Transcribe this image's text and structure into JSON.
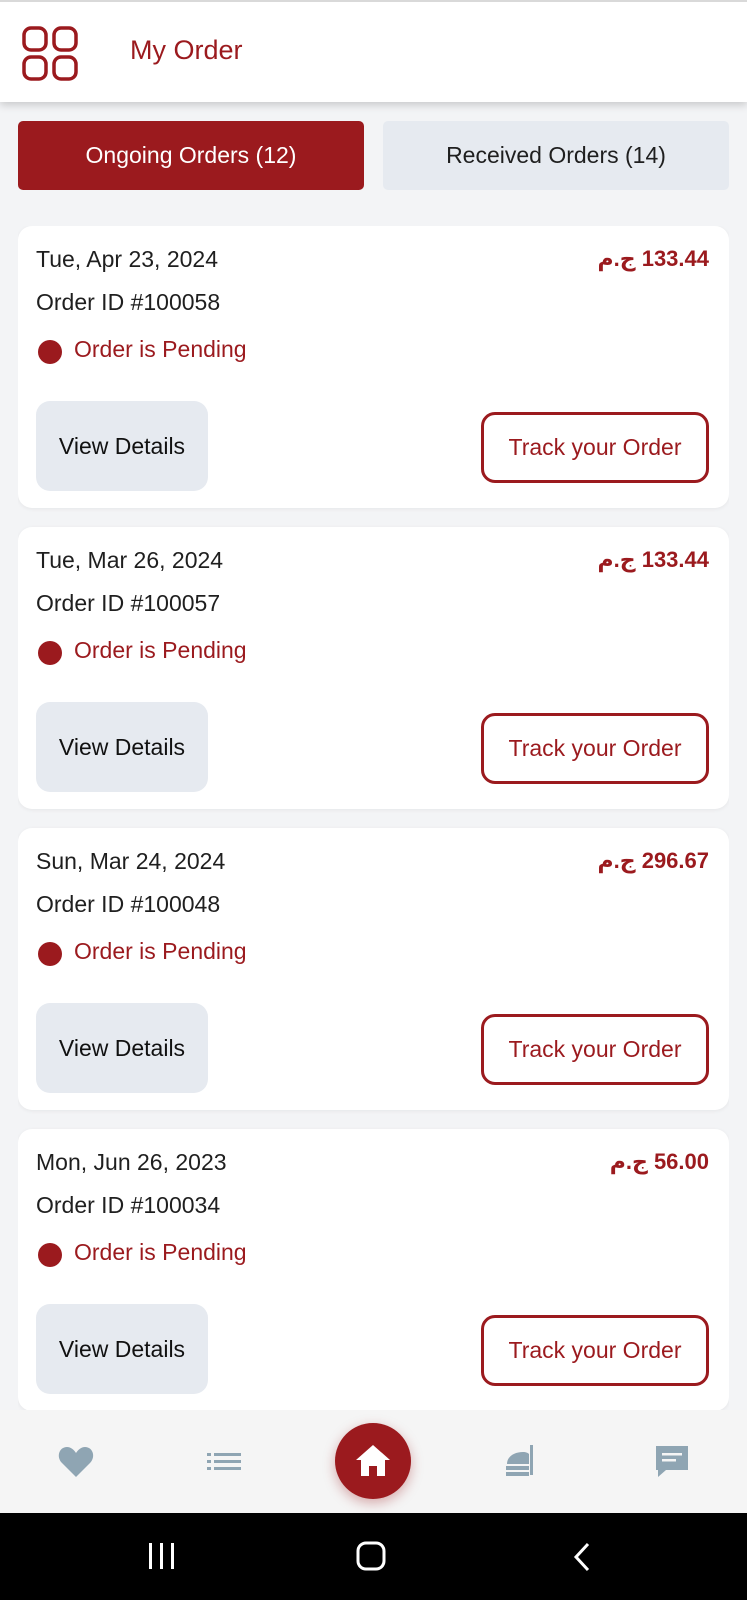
{
  "header": {
    "title": "My Order",
    "menu_icon": "grid-menu-icon"
  },
  "tabs": [
    {
      "label": "Ongoing Orders (12)",
      "active": true
    },
    {
      "label": "Received Orders (14)",
      "active": false
    }
  ],
  "orders": [
    {
      "date": "Tue, Apr 23, 2024",
      "order_id": "Order ID #100058",
      "price": "133.44 ج.م",
      "status": "Order is Pending",
      "view_label": "View Details",
      "track_label": "Track your Order"
    },
    {
      "date": "Tue, Mar 26, 2024",
      "order_id": "Order ID #100057",
      "price": "133.44 ج.م",
      "status": "Order is Pending",
      "view_label": "View Details",
      "track_label": "Track your Order"
    },
    {
      "date": "Sun, Mar 24, 2024",
      "order_id": "Order ID #100048",
      "price": "296.67 ج.م",
      "status": "Order is Pending",
      "view_label": "View Details",
      "track_label": "Track your Order"
    },
    {
      "date": "Mon, Jun 26, 2023",
      "order_id": "Order ID #100034",
      "price": "56.00 ج.م",
      "status": "Order is Pending",
      "view_label": "View Details",
      "track_label": "Track your Order"
    }
  ],
  "bottom_nav": {
    "items": [
      "heart-icon",
      "list-icon",
      "home-icon",
      "food-tray-icon",
      "chat-icon"
    ],
    "active": "home-icon"
  },
  "colors": {
    "brand": "#9b1a1e",
    "icon_muted": "#8fa5b3",
    "tab_inactive_bg": "#e6eaf0",
    "background": "#f3f4f6"
  }
}
